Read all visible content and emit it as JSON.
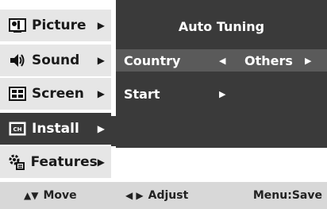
{
  "menu": {
    "items": [
      {
        "label": "Picture",
        "icon": "picture-icon",
        "arrow": "▶"
      },
      {
        "label": "Sound",
        "icon": "speaker-icon",
        "arrow": "▶"
      },
      {
        "label": "Screen",
        "icon": "screen-icon",
        "arrow": "▶"
      },
      {
        "label": "Install",
        "icon": "install-icon",
        "arrow": "▶"
      },
      {
        "label": "Features",
        "icon": "features-icon",
        "arrow": "▶"
      }
    ],
    "active_index": 3
  },
  "panel": {
    "title": "Auto Tuning",
    "country": {
      "label": "Country",
      "left_arrow": "◀",
      "value": "Others",
      "right_arrow": "▶"
    },
    "start": {
      "label": "Start",
      "arrow": "▶"
    }
  },
  "footer": {
    "move": {
      "keys": "▲▼",
      "label": "Move"
    },
    "adjust": {
      "keys": "◀ ▶",
      "label": "Adjust"
    },
    "menu_save": "Menu:Save"
  },
  "colors": {
    "panel_bg": "#3a3a3a",
    "selected_row_bg": "#5a5a5a",
    "menu_bg": "#e6e6e6",
    "bottom_bar_bg": "#d8d8d8"
  }
}
